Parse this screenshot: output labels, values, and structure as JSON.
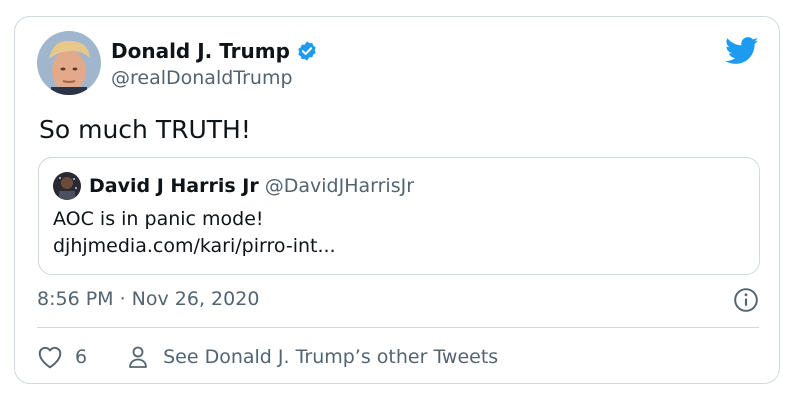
{
  "author": {
    "name": "Donald J. Trump",
    "handle": "@realDonaldTrump",
    "verified": true,
    "avatar_icon": "profile-photo"
  },
  "tweet": {
    "text": "So much TRUTH!",
    "timestamp": "8:56 PM · Nov 26, 2020",
    "like_count": "6",
    "other_tweets_label": "See Donald J. Trump’s other Tweets"
  },
  "quote": {
    "name": "David J Harris Jr",
    "handle": "@DavidJHarrisJr",
    "line1": "AOC is in panic mode!",
    "line2": "djhjmedia.com/kari/pirro-int..."
  },
  "colors": {
    "brand_blue": "#1d9bf0",
    "secondary_text": "#536471",
    "border": "#cfd9de"
  }
}
